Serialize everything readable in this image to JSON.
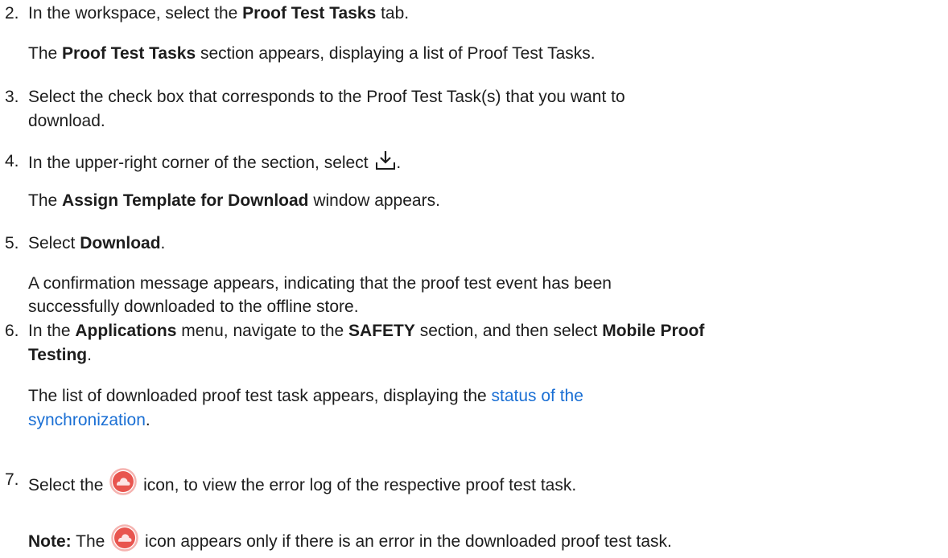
{
  "steps": [
    {
      "number": "2.",
      "pre": "In the workspace, select the ",
      "bold": "Proof Test Tasks",
      "post": " tab.",
      "result_bold": "Proof Test Tasks",
      "result_post": " section appears, displaying a list of Proof Test Tasks.",
      "result_pre": "The "
    },
    {
      "number": "3.",
      "line1": "Select the check box that corresponds to the Proof Test Task(s) that you want to",
      "line2": "download."
    },
    {
      "number": "4.",
      "pre": "In the upper-right corner of the section, select ",
      "post": ".",
      "icon": "download-icon",
      "result_pre": "The ",
      "result_bold": "Assign Template for Download",
      "result_post": " window appears."
    },
    {
      "number": "5.",
      "pre": "Select ",
      "bold": "Download",
      "post": ".",
      "result_line1": "A confirmation message appears, indicating that the proof test event has been",
      "result_line2": "successfully downloaded to the offline store."
    },
    {
      "number": "6.",
      "pre": "In the ",
      "bold1": "Applications",
      "mid1": " menu, navigate to the ",
      "bold2": "SAFETY",
      "mid2": " section, and then select ",
      "bold3a": "Mobile Proof",
      "bold3b": "Testing",
      "post": ".",
      "result_pre": "The list of downloaded proof test task appears, displaying the ",
      "result_link1": "status of the",
      "result_link2": "synchronization",
      "result_post": "."
    },
    {
      "number": "7.",
      "pre": "Select the ",
      "post": " icon, to view the error log of the respective proof test task.",
      "icon": "cloud-error-icon"
    }
  ],
  "note": {
    "label": "Note:",
    "pre": " The ",
    "post": " icon appears only if there is an error in the downloaded proof test task.",
    "icon": "cloud-error-icon"
  },
  "colors": {
    "text": "#1d1d1d",
    "link": "#1a6fd4",
    "error_icon_fill": "#e8554f",
    "error_icon_ring": "#f5b3b0"
  }
}
